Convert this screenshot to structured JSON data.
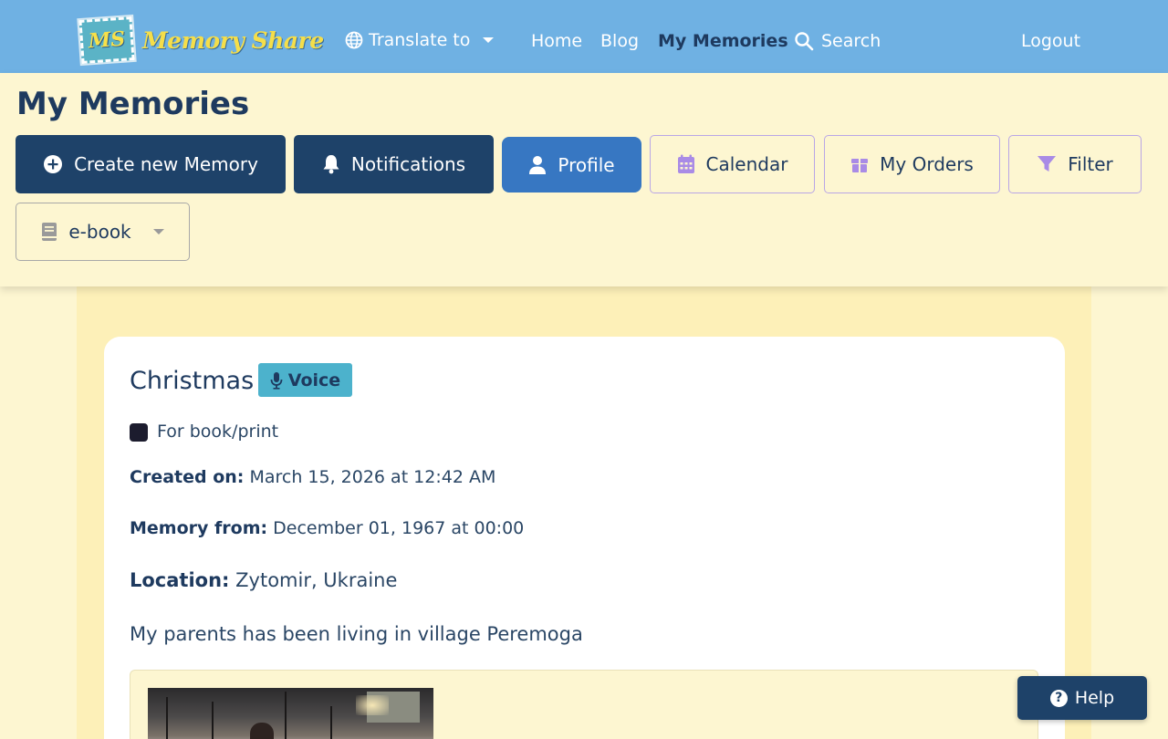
{
  "brand": {
    "logo_mark": "MS",
    "name": "Memory Share"
  },
  "nav": {
    "translate_label": "Translate to",
    "links": [
      {
        "label": "Home"
      },
      {
        "label": "Blog"
      },
      {
        "label": "My Memories",
        "active": true
      }
    ],
    "search_label": "Search",
    "logout_label": "Logout"
  },
  "page": {
    "title": "My Memories"
  },
  "toolbar": {
    "create_label": "Create new Memory",
    "notifications_label": "Notifications",
    "profile_label": "Profile",
    "calendar_label": "Calendar",
    "orders_label": "My Orders",
    "filter_label": "Filter",
    "ebook_label": "e-book"
  },
  "memory": {
    "title": "Christmas",
    "badge": "Voice",
    "checkbox_label": "For book/print",
    "checkbox_checked": true,
    "created_label": "Created on:",
    "created_value": "March 15, 2026 at 12:42 AM",
    "from_label": "Memory from:",
    "from_value": "December 01, 1967 at 00:00",
    "location_label": "Location:",
    "location_value": "Zytomir, Ukraine",
    "description": "My parents has been living in village Peremoga"
  },
  "help": {
    "label": "Help"
  },
  "colors": {
    "navbar": "#6fb1e3",
    "page_bg": "#fdf6d1",
    "primary_dark": "#1e4269",
    "primary_blue": "#3777c2",
    "outline_purple": "#b9a6e6",
    "badge_teal": "#4cb2cc",
    "logo_yellow": "#f5de4a"
  },
  "icons": [
    "globe-icon",
    "search-icon",
    "plus-circle-icon",
    "bell-icon",
    "user-icon",
    "calendar-icon",
    "gift-icon",
    "filter-icon",
    "book-icon",
    "microphone-icon",
    "question-circle-icon"
  ]
}
